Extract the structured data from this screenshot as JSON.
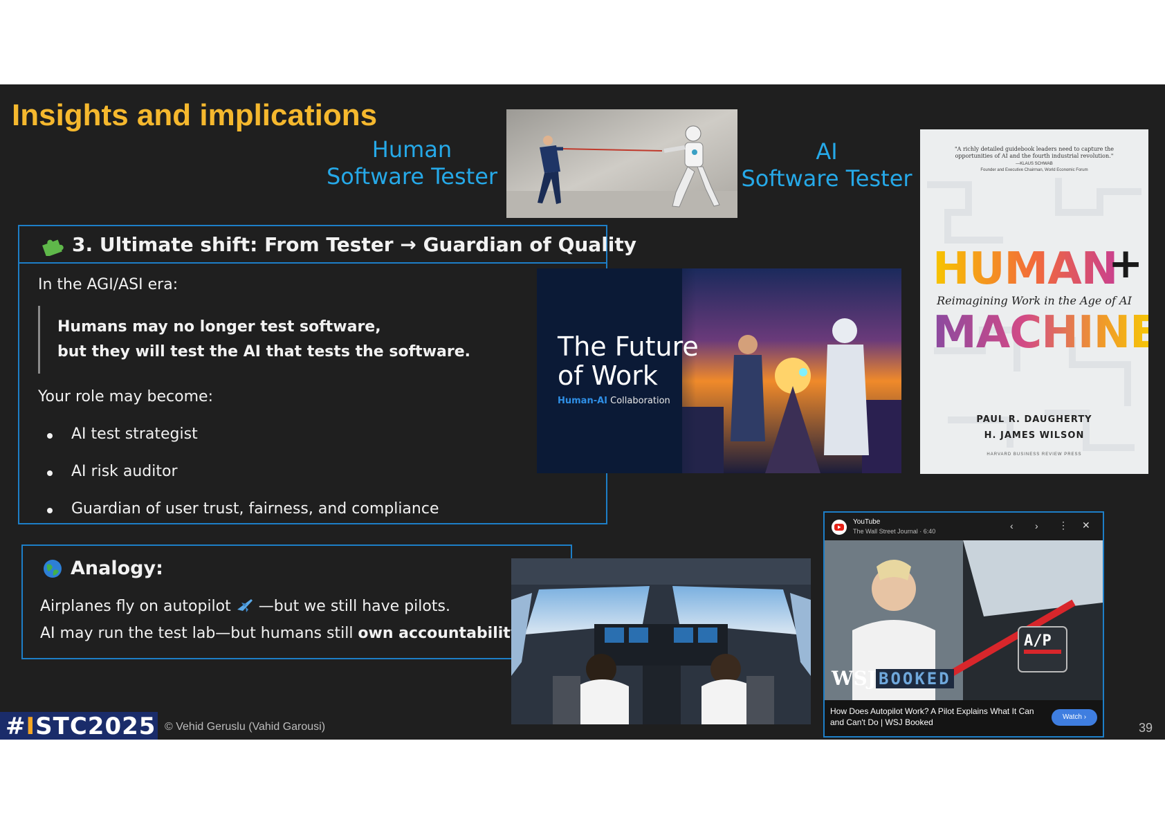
{
  "slide": {
    "title": "Insights and implications",
    "human_label": "Human\nSoftware Tester",
    "ai_label": "AI\nSoftware Tester",
    "page_number": "39",
    "footer_copyright": "© Vehid Geruslu (Vahid Garousi)",
    "footer_logo_prefix": "#",
    "footer_logo_i": "I",
    "footer_logo_stc": "STC",
    "footer_logo_year": "2025"
  },
  "shift": {
    "heading": "3. Ultimate shift: From Tester → Guardian of Quality",
    "era": "In the AGI/ASI era:",
    "quote_line1": "Humans may no longer test software,",
    "quote_line2": "but they will test the AI that tests the software.",
    "role_intro": "Your role may become:",
    "roles": [
      "AI test strategist",
      "AI risk auditor",
      "Guardian of user trust, fairness, and compliance"
    ]
  },
  "analogy": {
    "heading": "Analogy:",
    "line1_a": "Airplanes fly on autopilot",
    "line1_b": "—but we still have pilots.",
    "line2_a": "AI may run the test lab—but humans still ",
    "line2_b": "own accountability",
    "line2_c": "."
  },
  "future_image": {
    "title_line1": "The Future",
    "title_line2": "of Work",
    "subtitle_a": "Human-AI",
    "subtitle_b": " Collaboration"
  },
  "book": {
    "quote": "\"A richly detailed guidebook leaders need to capture the opportunities of AI and the fourth industrial revolution.\"",
    "quote_author": "—KLAUS SCHWAB",
    "quote_author_role": "Founder and Executive Chairman, World Economic Forum",
    "title_top": "HUMAN",
    "plus": "+",
    "subtitle": "Reimagining Work in the Age of AI",
    "title_bottom": "MACHINE",
    "author1": "PAUL R. DAUGHERTY",
    "author2": "H. JAMES WILSON",
    "publisher": "HARVARD BUSINESS REVIEW PRESS"
  },
  "video": {
    "platform": "YouTube",
    "channel": "The Wall Street Journal · 6:40",
    "caption": "How Does Autopilot Work? A Pilot Explains What It Can and Can't Do | WSJ Booked",
    "watch": "Watch ›",
    "brand_wsj": "WSJ",
    "brand_booked": "BOOKED",
    "ap": "A/P"
  },
  "colors": {
    "title": "#f5b82e",
    "accent_blue": "#26a9e8",
    "box_border": "#1d7fc8",
    "slide_bg": "#1f1f1f"
  }
}
